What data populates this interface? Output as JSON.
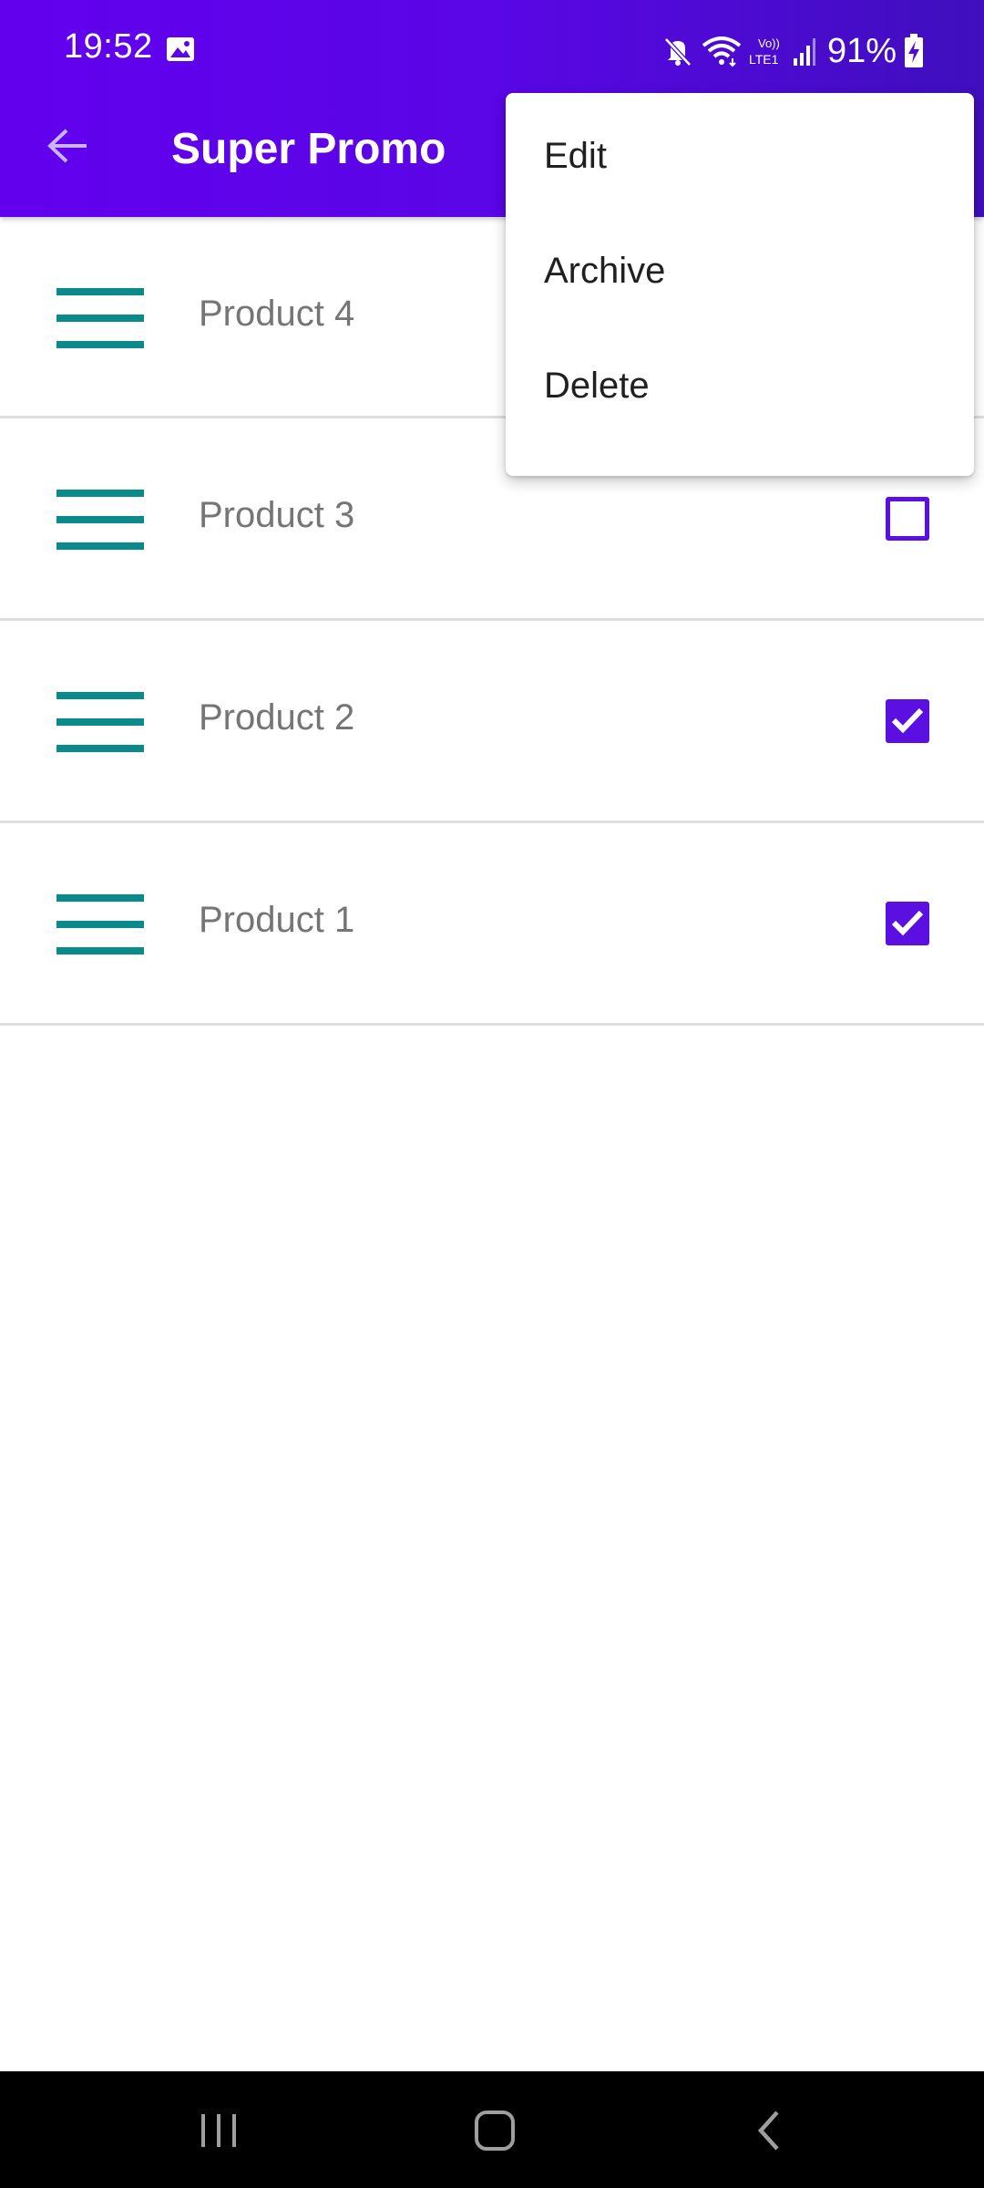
{
  "status_bar": {
    "time": "19:52",
    "battery": "91%",
    "icons": [
      "gallery-icon",
      "mute-icon",
      "wifi-icon",
      "volte-icon",
      "signal-icon",
      "battery-charging-icon"
    ]
  },
  "toolbar": {
    "back_icon": "arrow-back-icon",
    "title": "Super Promo"
  },
  "products": [
    {
      "label": "Product 4",
      "checked": null
    },
    {
      "label": "Product 3",
      "checked": false
    },
    {
      "label": "Product 2",
      "checked": true
    },
    {
      "label": "Product 1",
      "checked": true
    }
  ],
  "overflow_menu": {
    "items": [
      "Edit",
      "Archive",
      "Delete"
    ]
  },
  "nav_bar": {
    "buttons": [
      "recent-apps-icon",
      "home-icon",
      "back-icon"
    ]
  },
  "colors": {
    "primary": "#6200ee",
    "checkbox": "#5b0fe0",
    "drag_handle": "#0a8a8a",
    "label": "#757575"
  }
}
